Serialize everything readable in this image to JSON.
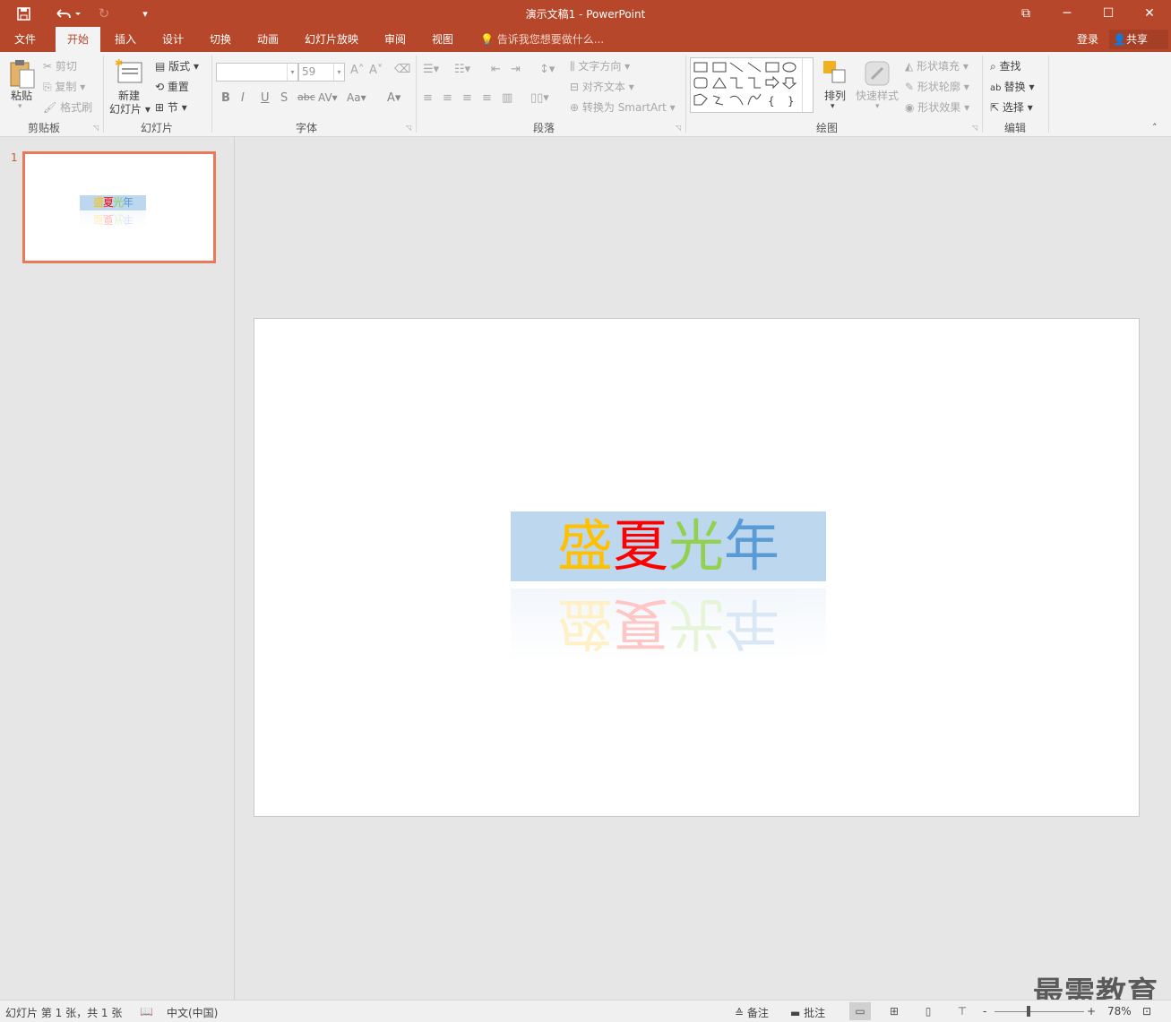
{
  "window": {
    "title": "演示文稿1 - PowerPoint",
    "controls": {
      "restore_ribbon": "⧉",
      "minimize": "─",
      "maximize": "☐",
      "close": "✕"
    }
  },
  "quick_access": {
    "save": "save-icon",
    "undo": "undo-icon",
    "redo": "redo-icon",
    "customize": "customize-icon"
  },
  "tabs": [
    {
      "label": "文件"
    },
    {
      "label": "开始"
    },
    {
      "label": "插入"
    },
    {
      "label": "设计"
    },
    {
      "label": "切换"
    },
    {
      "label": "动画"
    },
    {
      "label": "幻灯片放映"
    },
    {
      "label": "审阅"
    },
    {
      "label": "视图"
    }
  ],
  "active_tab": "开始",
  "tell_me": "告诉我您想要做什么...",
  "account": {
    "login": "登录",
    "share": "共享"
  },
  "ribbon": {
    "clipboard": {
      "paste": "粘贴",
      "cut": "剪切",
      "copy": "复制",
      "format_painter": "格式刷",
      "label": "剪贴板"
    },
    "slides": {
      "new_slide_1": "新建",
      "new_slide_2": "幻灯片",
      "layout": "版式",
      "reset": "重置",
      "section": "节",
      "label": "幻灯片"
    },
    "font": {
      "font_name": "",
      "font_size": "59",
      "label": "字体"
    },
    "paragraph": {
      "text_direction": "文字方向",
      "align_text": "对齐文本",
      "smartart": "转换为 SmartArt",
      "label": "段落"
    },
    "drawing": {
      "arrange": "排列",
      "quick_styles": "快速样式",
      "shape_fill": "形状填充",
      "shape_outline": "形状轮廓",
      "shape_effects": "形状效果",
      "label": "绘图"
    },
    "editing": {
      "find": "查找",
      "replace": "替换",
      "select": "选择",
      "label": "编辑"
    }
  },
  "slides_panel": {
    "slide_number": "1"
  },
  "slide": {
    "title_chars": [
      "盛",
      "夏",
      "光",
      "年"
    ],
    "char_colors": [
      "#ffc000",
      "#ff0000",
      "#92d050",
      "#5b9bd5"
    ],
    "box_color": "#bdd7ee"
  },
  "status": {
    "slide_info": "幻灯片 第 1 张，共 1 张",
    "language": "中文(中国)",
    "notes": "备注",
    "comments": "批注",
    "zoom": "78%"
  },
  "watermark": "最需教育"
}
